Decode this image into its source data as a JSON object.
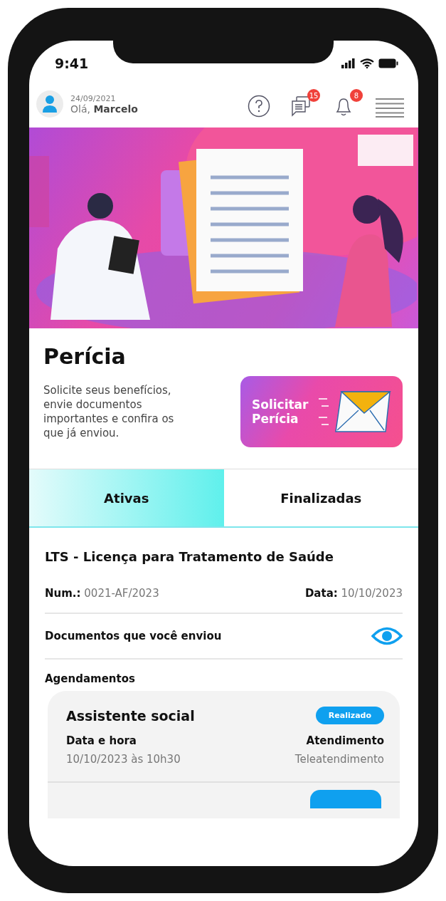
{
  "status_bar": {
    "time": "9:41"
  },
  "header": {
    "date": "24/09/2021",
    "greeting": "Olá, **Marcelo**",
    "messages_badge": "15",
    "notifications_badge": "8"
  },
  "intro": {
    "title": "Perícia",
    "description": "Solicite seus benefícios, envie documentos importantes e confira os que já enviou.",
    "button": "Solicitar Perícia"
  },
  "tabs": [
    {
      "label": "Ativas",
      "selected": true
    },
    {
      "label": "Finalizadas",
      "selected": false
    }
  ],
  "request": {
    "title": "LTS - Licença para Tratamento de Saúde",
    "number": "**Num.:** 0021-AF/2023",
    "date": "**Data:** 10/10/2023",
    "documents_label": "Documentos que você enviou",
    "schedules_title": "Agendamentos",
    "appointments": [
      {
        "title": "Assistente social",
        "status": "Realizado",
        "datetime_label": "Data e hora",
        "datetime": "10/10/2023 às 10h30",
        "mode_label": "Atendimento",
        "mode": "Teleatendimento"
      }
    ]
  }
}
